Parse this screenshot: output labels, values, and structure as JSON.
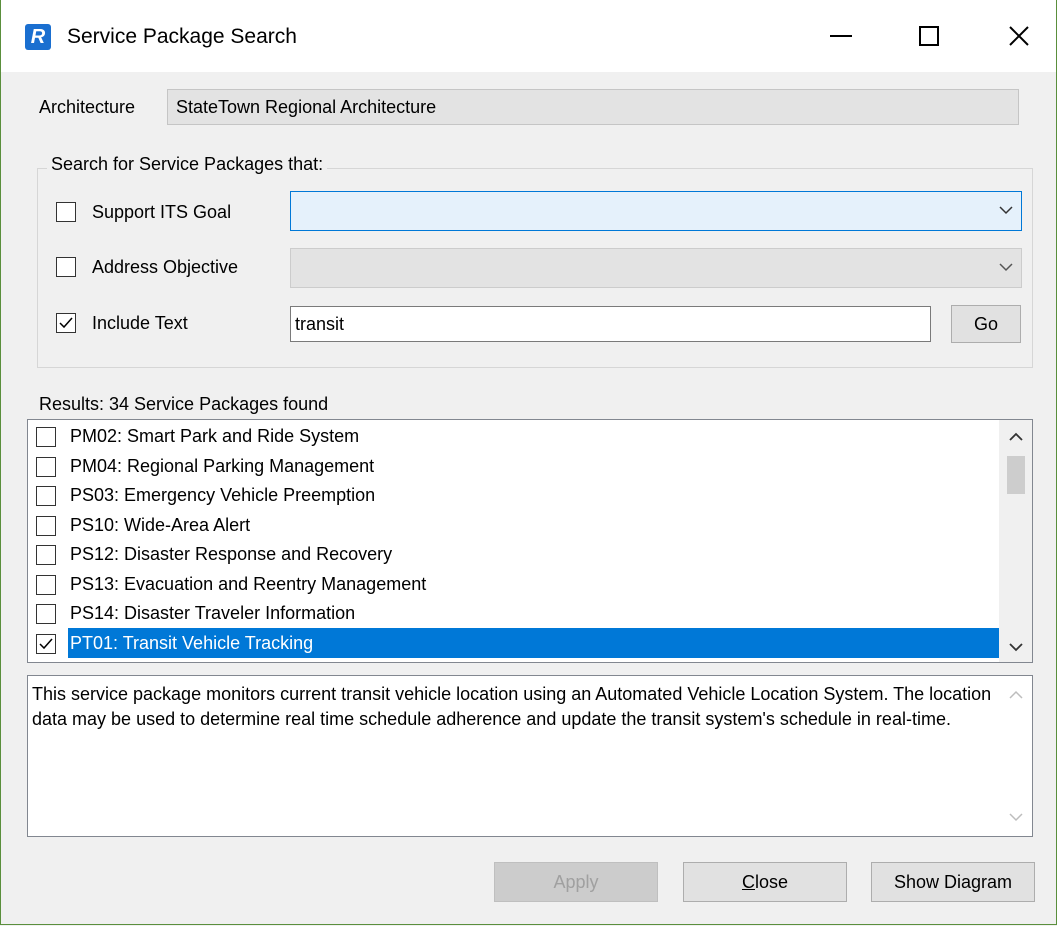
{
  "window": {
    "title": "Service Package Search",
    "icon_letter": "R",
    "icon_color": "#1a6fd0",
    "controls": [
      "minimize-icon",
      "maximize-icon",
      "close-icon"
    ]
  },
  "architecture": {
    "label": "Architecture",
    "value": "StateTown Regional Architecture"
  },
  "search": {
    "group_title": "Search for Service Packages that:",
    "support_goal": {
      "label": "Support ITS Goal",
      "checked": false,
      "value": ""
    },
    "address_objective": {
      "label": "Address Objective",
      "checked": false,
      "value": ""
    },
    "include_text": {
      "label": "Include Text",
      "checked": true,
      "value": "transit"
    },
    "go_label": "Go"
  },
  "results": {
    "label": "Results: 34 Service Packages found",
    "items": [
      {
        "label": "PM02: Smart Park and Ride System",
        "checked": false,
        "selected": false
      },
      {
        "label": "PM04: Regional Parking Management",
        "checked": false,
        "selected": false
      },
      {
        "label": "PS03: Emergency Vehicle Preemption",
        "checked": false,
        "selected": false
      },
      {
        "label": "PS10: Wide-Area Alert",
        "checked": false,
        "selected": false
      },
      {
        "label": "PS12: Disaster Response and Recovery",
        "checked": false,
        "selected": false
      },
      {
        "label": "PS13: Evacuation and Reentry Management",
        "checked": false,
        "selected": false
      },
      {
        "label": "PS14: Disaster Traveler Information",
        "checked": false,
        "selected": false
      },
      {
        "label": "PT01: Transit Vehicle Tracking",
        "checked": true,
        "selected": true
      }
    ],
    "selection_color": "#0078d7"
  },
  "description": {
    "text": "This service package monitors current transit vehicle location using an Automated Vehicle Location System.  The location data may be used to determine real time schedule adherence and update the transit system's schedule in real-time."
  },
  "buttons": {
    "apply_label": "Apply",
    "close_label_prefix": "C",
    "close_label_rest": "lose",
    "show_diagram_label": "Show Diagram"
  }
}
